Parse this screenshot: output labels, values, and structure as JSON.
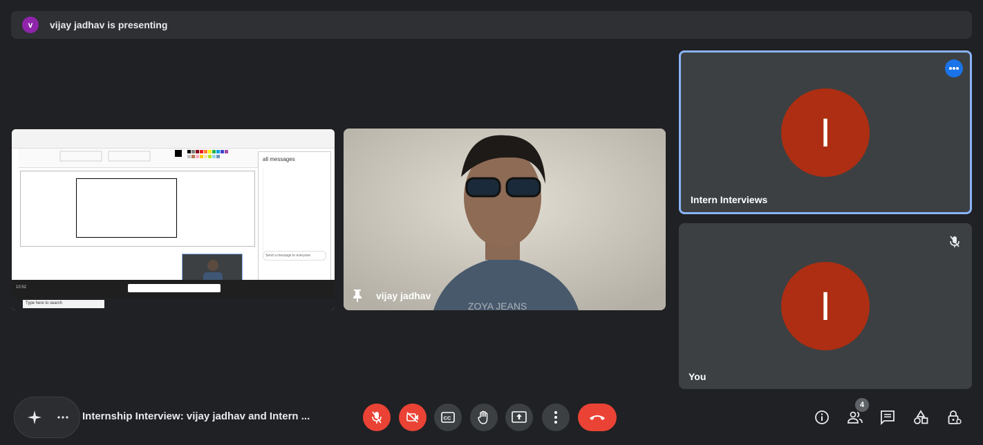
{
  "banner": {
    "avatar_letter": "v",
    "text": "vijay jadhav is presenting"
  },
  "presentation": {
    "side_panel_title": "all messages",
    "side_panel_input": "Send a message to everyone",
    "taskbar_search": "Type here to search",
    "clock": "10:52"
  },
  "camera": {
    "name": "vijay jadhav",
    "shirt_text": "ZOYA JEANS"
  },
  "participants": [
    {
      "name": "Intern Interviews",
      "initial": "I"
    },
    {
      "name": "You",
      "initial": "I"
    }
  ],
  "meeting": {
    "title": "Internship Interview: vijay jadhav and Intern ..."
  },
  "people_count": "4",
  "colors": {
    "background": "#202124",
    "tile": "#3c4043",
    "avatar": "#ad2e12",
    "accent": "#8ab4f8",
    "danger": "#ea4335"
  },
  "icons": [
    "mic-off-icon",
    "camera-off-icon",
    "captions-icon",
    "raise-hand-icon",
    "present-icon",
    "more-vert-icon",
    "end-call-icon",
    "info-icon",
    "people-icon",
    "chat-icon",
    "activities-icon",
    "host-controls-icon"
  ]
}
